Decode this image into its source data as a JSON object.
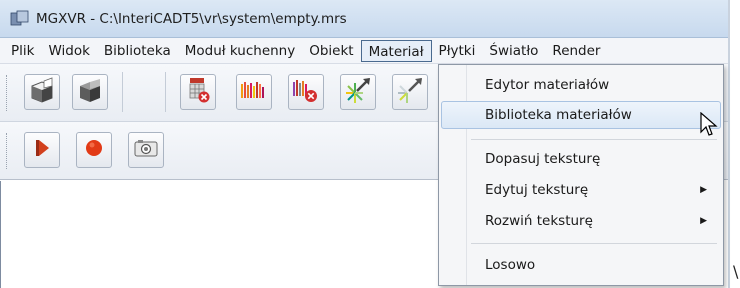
{
  "window": {
    "title": "MGXVR - C:\\InteriCADT5\\vr\\system\\empty.mrs",
    "icon": "mgxvr-app-icon"
  },
  "menubar": {
    "items": [
      "Plik",
      "Widok",
      "Biblioteka",
      "Moduł kuchenny",
      "Obiekt",
      "Materiał",
      "Płytki",
      "Światło",
      "Render"
    ],
    "active": "Materiał"
  },
  "toolbar1": {
    "buttons": [
      "cube-open-icon",
      "cube-solid-icon",
      "material-grid-delete-icon",
      "color-bars-icon",
      "color-bars-delete-icon",
      "starburst-arrow-icon",
      "starburst-arrow-alt-icon"
    ]
  },
  "toolbar2": {
    "buttons": [
      "play-icon",
      "record-icon",
      "camera-icon"
    ]
  },
  "dropdown": {
    "items": [
      {
        "label": "Edytor materiałów",
        "submenu": false
      },
      {
        "label": "Biblioteka materiałów",
        "submenu": false,
        "hovered": true
      },
      {
        "label": "Dopasuj teksturę",
        "submenu": false
      },
      {
        "label": "Edytuj teksturę",
        "submenu": true
      },
      {
        "label": "Rozwiń teksturę",
        "submenu": true
      },
      {
        "label": "Losowo",
        "submenu": false
      }
    ]
  },
  "colors": {
    "titlebar": "#c7d9ee",
    "hover": "#dbe8f6",
    "record": "#e23a16",
    "play": "#c8381c"
  },
  "stray_char": "\\"
}
